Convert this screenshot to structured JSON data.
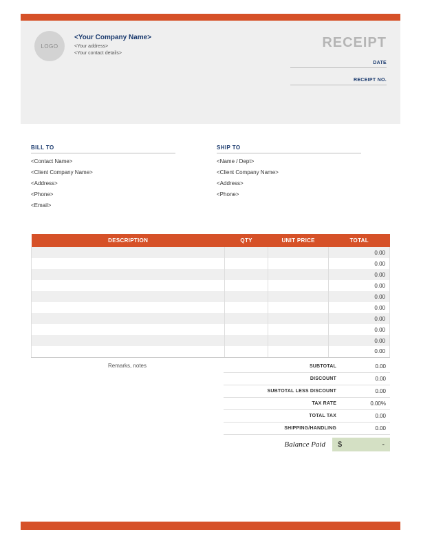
{
  "logo_text": "LOGO",
  "company": {
    "name": "<Your Company Name>",
    "address": "<Your address>",
    "contact": "<Your contact details>"
  },
  "receipt": {
    "title": "RECEIPT",
    "date_label": "DATE",
    "number_label": "RECEIPT NO."
  },
  "bill_to": {
    "heading": "BILL TO",
    "lines": [
      "<Contact Name>",
      "<Client Company Name>",
      "<Address>",
      "<Phone>",
      "<Email>"
    ]
  },
  "ship_to": {
    "heading": "SHIP TO",
    "lines": [
      "<Name / Dept>",
      "<Client Company Name>",
      "<Address>",
      "<Phone>"
    ]
  },
  "table": {
    "headers": {
      "description": "DESCRIPTION",
      "qty": "QTY",
      "unit_price": "UNIT PRICE",
      "total": "TOTAL"
    },
    "rows": [
      {
        "total": "0.00"
      },
      {
        "total": "0.00"
      },
      {
        "total": "0.00"
      },
      {
        "total": "0.00"
      },
      {
        "total": "0.00"
      },
      {
        "total": "0.00"
      },
      {
        "total": "0.00"
      },
      {
        "total": "0.00"
      },
      {
        "total": "0.00"
      },
      {
        "total": "0.00"
      }
    ]
  },
  "remarks_label": "Remarks, notes",
  "totals": {
    "subtotal": {
      "label": "SUBTOTAL",
      "value": "0.00"
    },
    "discount": {
      "label": "DISCOUNT",
      "value": "0.00"
    },
    "subtotal_less": {
      "label": "SUBTOTAL LESS DISCOUNT",
      "value": "0.00"
    },
    "tax_rate": {
      "label": "TAX RATE",
      "value": "0.00%"
    },
    "total_tax": {
      "label": "TOTAL TAX",
      "value": "0.00"
    },
    "shipping": {
      "label": "SHIPPING/HANDLING",
      "value": "0.00"
    }
  },
  "balance": {
    "label": "Balance Paid",
    "currency": "$",
    "value": "-"
  }
}
